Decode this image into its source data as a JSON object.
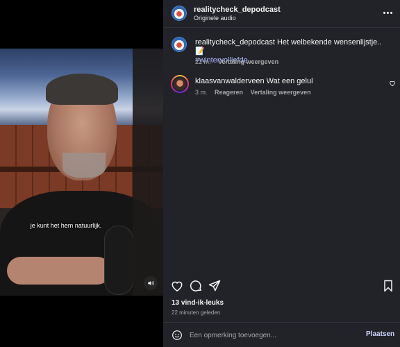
{
  "video": {
    "caption": "je kunt het hem natuurlijk."
  },
  "header": {
    "username": "realitycheck_depodcast",
    "subtitle": "Originele audio"
  },
  "comments": [
    {
      "username": "realitycheck_depodcast",
      "text": "Het welbekende wensenlijstje..📝",
      "hashtag": "#wintervolliefde",
      "time": "22 m.",
      "translate": "Vertaling weergeven"
    },
    {
      "username": "klaasvanwalderveen",
      "text": "Wat een gelul",
      "time": "3 m.",
      "reply": "Reageren",
      "translate": "Vertaling weergeven"
    }
  ],
  "post": {
    "likes": "13 vind-ik-leuks",
    "time_ago": "22 minuten geleden"
  },
  "add_comment": {
    "placeholder": "Een opmerking toevoegen...",
    "post_label": "Plaatsen"
  },
  "icons": {
    "more": "more-horizontal-icon",
    "like": "heart-icon",
    "comment": "comment-bubble-icon",
    "share": "paper-plane-icon",
    "save": "bookmark-icon",
    "emoji": "smiley-icon",
    "mute": "speaker-icon"
  },
  "colors": {
    "panel_bg": "#212328",
    "link": "#a5b4fc",
    "muted_text": "#a8a8a8"
  }
}
